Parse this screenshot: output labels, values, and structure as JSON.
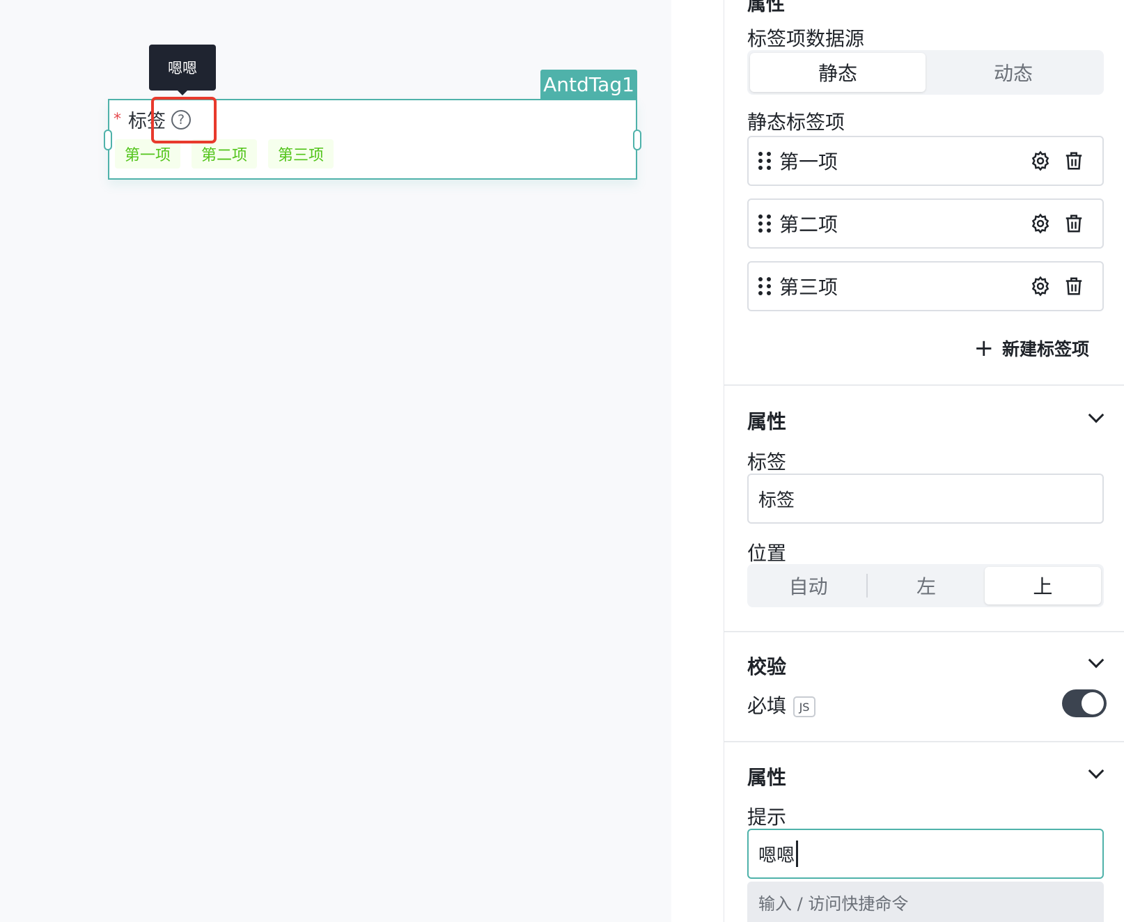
{
  "canvas": {
    "tooltip_text": "嗯嗯",
    "component_name": "AntdTag1",
    "field_label": "标签",
    "required_mark": "*",
    "help_symbol": "?",
    "tags": [
      "第一项",
      "第二项",
      "第三项"
    ],
    "tag_color": "#52c41a",
    "accent_color": "#4fb2aa",
    "highlight_color": "#e83a2d"
  },
  "panel": {
    "cut_title": "属性",
    "data_source": {
      "label": "标签项数据源",
      "options": [
        "静态",
        "动态"
      ],
      "selected": "静态"
    },
    "static_items": {
      "label": "静态标签项",
      "items": [
        "第一项",
        "第二项",
        "第三项"
      ],
      "add_label": "新建标签项",
      "add_symbol": "+"
    },
    "attributes": {
      "title": "属性",
      "label_field": {
        "label": "标签",
        "value": "标签"
      },
      "position": {
        "label": "位置",
        "options": [
          "自动",
          "左",
          "上"
        ],
        "selected": "上"
      }
    },
    "validation": {
      "title": "校验",
      "required_label": "必填",
      "js_badge": "JS",
      "required_on": true
    },
    "attributes2": {
      "title": "属性",
      "hint_label": "提示",
      "hint_value": "嗯嗯",
      "command_hint": "输入 / 访问快捷命令"
    }
  }
}
